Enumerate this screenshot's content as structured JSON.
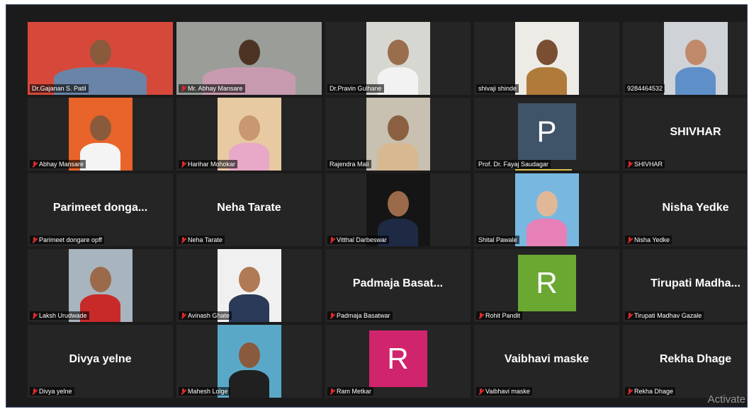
{
  "meeting": {
    "watermark": "Activate",
    "participants": [
      {
        "name": "Dr.Gajanan S. Patil",
        "type": "video",
        "muted": false,
        "active": true,
        "bg": "#d6493a",
        "skin": "#8a5a3c",
        "shirt": "#6a84a8",
        "wide": true
      },
      {
        "name": "Mr. Abhay Mansare",
        "type": "video",
        "muted": true,
        "bg": "#9a9d98",
        "skin": "#4c3323",
        "shirt": "#c89aaf",
        "wide": true
      },
      {
        "name": "Dr.Pravin Gulhane",
        "type": "video",
        "muted": false,
        "bg": "#d7d7d2",
        "skin": "#9a6d4d",
        "shirt": "#f2f2f2"
      },
      {
        "name": "shivaji shinde",
        "type": "video",
        "muted": false,
        "bg": "#ecebe6",
        "skin": "#7a4e32",
        "shirt": "#b07a3a"
      },
      {
        "name": "9284464532",
        "type": "video",
        "muted": false,
        "bg": "#cfd2d6",
        "skin": "#c08a6a",
        "shirt": "#5f8fc9"
      },
      {
        "name": "Abhay Mansare",
        "type": "video",
        "muted": true,
        "bg": "#e8642a",
        "skin": "#8a5a3c",
        "shirt": "#f4f4f4"
      },
      {
        "name": "Harihar Mohokar",
        "type": "video",
        "muted": true,
        "bg": "#e7c9a2",
        "skin": "#c89870",
        "shirt": "#e8a8c8"
      },
      {
        "name": "Rajendra Mali",
        "type": "video",
        "muted": false,
        "bg": "#c8c0b0",
        "skin": "#8a6040",
        "shirt": "#d8b890"
      },
      {
        "name": "Prof. Dr. Fayaj Saudagar",
        "type": "avatar",
        "muted": false,
        "initial": "P",
        "color": "#3f5468",
        "speaking": true
      },
      {
        "name": "SHIVHAR",
        "type": "name",
        "display": "SHIVHAR",
        "muted": true
      },
      {
        "name": "Parimeet dongare opff",
        "type": "name",
        "display": "Parimeet donga...",
        "muted": true
      },
      {
        "name": "Neha Tarate",
        "type": "name",
        "display": "Neha Tarate",
        "muted": true
      },
      {
        "name": "Vitthal Darbeswar",
        "type": "video",
        "muted": true,
        "bg": "#151515",
        "skin": "#9a6a4a",
        "shirt": "#1e2a44"
      },
      {
        "name": "Shital Pawale",
        "type": "video",
        "muted": false,
        "bg": "#78b8e0",
        "skin": "#e0b898",
        "shirt": "#e880b8"
      },
      {
        "name": "Nisha Yedke",
        "type": "name",
        "display": "Nisha Yedke",
        "muted": true
      },
      {
        "name": "Laksh Urudwade",
        "type": "video",
        "muted": true,
        "bg": "#a8b4be",
        "skin": "#9a6a4a",
        "shirt": "#c82a2a"
      },
      {
        "name": "Avinash Ghate",
        "type": "video",
        "muted": true,
        "bg": "#f0f0f0",
        "skin": "#b07a54",
        "shirt": "#2a3a58"
      },
      {
        "name": "Padmaja Basatwar",
        "type": "name",
        "display": "Padmaja  Basat...",
        "muted": true
      },
      {
        "name": "Rohit Pandit",
        "type": "avatar",
        "muted": true,
        "initial": "R",
        "color": "#6aa832"
      },
      {
        "name": "Tirupati Madhav Gazale",
        "type": "name",
        "display": "Tirupati  Madha...",
        "muted": true
      },
      {
        "name": "Divya yelne",
        "type": "name",
        "display": "Divya yelne",
        "muted": true
      },
      {
        "name": "Mahesh Lolge",
        "type": "video",
        "muted": true,
        "bg": "#5aa8c8",
        "skin": "#8a5a3c",
        "shirt": "#202020"
      },
      {
        "name": "Ram Metkar",
        "type": "avatar",
        "muted": true,
        "initial": "R",
        "color": "#d0246c"
      },
      {
        "name": "Vaibhavi maske",
        "type": "name",
        "display": "Vaibhavi maske",
        "muted": true
      },
      {
        "name": "Rekha Dhage",
        "type": "name",
        "display": "Rekha Dhage",
        "muted": true
      }
    ]
  }
}
